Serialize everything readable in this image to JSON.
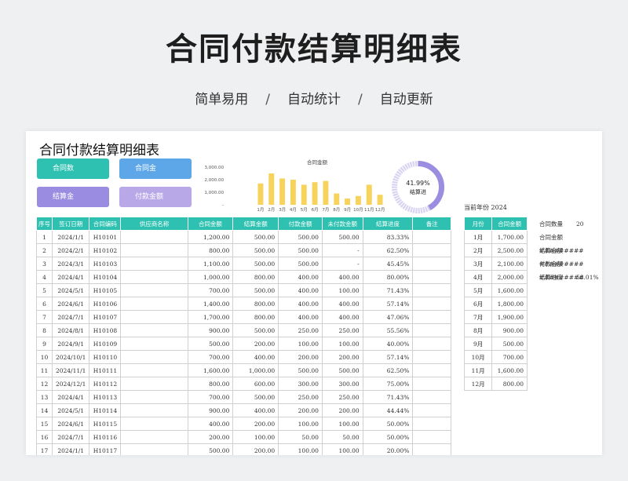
{
  "banner": {
    "title": "合同付款结算明细表",
    "subtitle": [
      "简单易用",
      "自动统计",
      "自动更新"
    ],
    "separator": "/"
  },
  "sheet": {
    "title": "合同付款结算明细表",
    "cards": [
      {
        "label": "合同数",
        "color": "#2ec1b1"
      },
      {
        "label": "合同金",
        "color": "#5da7e8"
      },
      {
        "label": "结算金",
        "color": "#9a8ce0"
      },
      {
        "label": "付款金额",
        "color": "#b8a8e8"
      }
    ],
    "year_label": "当前年份 2024",
    "donut": {
      "percent_text": "41.99%",
      "label": "结算进",
      "value": 0.4199,
      "color": "#9b8ee0",
      "track": "#d9d3f2"
    },
    "summary": [
      {
        "key": "合同数量",
        "value": "20"
      },
      {
        "key": "合同金额",
        "value": "#########"
      },
      {
        "key": "结算金额",
        "value": "#########"
      },
      {
        "key": "付款金额",
        "value": "#########"
      },
      {
        "key": "结算进度",
        "value": "58.01%"
      }
    ]
  },
  "chart_data": {
    "type": "bar",
    "title": "合同金额",
    "categories": [
      "1月",
      "2月",
      "3月",
      "4月",
      "5月",
      "6月",
      "7月",
      "8月",
      "9月",
      "10月",
      "11月",
      "12月"
    ],
    "values": [
      1700,
      2500,
      2100,
      2000,
      1600,
      1800,
      1900,
      900,
      500,
      700,
      1600,
      800
    ],
    "yticks": [
      "3,000.00",
      "2,000.00",
      "1,000.00",
      "-"
    ],
    "ylim": [
      0,
      3000
    ],
    "bar_color": "#f7d35c"
  },
  "main_table": {
    "headers": [
      "序号",
      "签订日期",
      "合同编码",
      "供应商名称",
      "合同金额",
      "结算金额",
      "付款金额",
      "未付款金额",
      "结算进度",
      "备注"
    ],
    "rows": [
      [
        "1",
        "2024/1/1",
        "H10101",
        "",
        "1,200.00",
        "500.00",
        "500.00",
        "500.00",
        "83.33%",
        ""
      ],
      [
        "2",
        "2024/2/1",
        "H10102",
        "",
        "800.00",
        "500.00",
        "500.00",
        "-",
        "62.50%",
        ""
      ],
      [
        "3",
        "2024/3/1",
        "H10103",
        "",
        "1,100.00",
        "500.00",
        "500.00",
        "-",
        "45.45%",
        ""
      ],
      [
        "4",
        "2024/4/1",
        "H10104",
        "",
        "1,000.00",
        "800.00",
        "400.00",
        "400.00",
        "80.00%",
        ""
      ],
      [
        "5",
        "2024/5/1",
        "H10105",
        "",
        "700.00",
        "500.00",
        "400.00",
        "100.00",
        "71.43%",
        ""
      ],
      [
        "6",
        "2024/6/1",
        "H10106",
        "",
        "1,400.00",
        "800.00",
        "400.00",
        "400.00",
        "57.14%",
        ""
      ],
      [
        "7",
        "2024/7/1",
        "H10107",
        "",
        "1,700.00",
        "800.00",
        "400.00",
        "400.00",
        "47.06%",
        ""
      ],
      [
        "8",
        "2024/8/1",
        "H10108",
        "",
        "900.00",
        "500.00",
        "250.00",
        "250.00",
        "55.56%",
        ""
      ],
      [
        "9",
        "2024/9/1",
        "H10109",
        "",
        "500.00",
        "200.00",
        "100.00",
        "100.00",
        "40.00%",
        ""
      ],
      [
        "10",
        "2024/10/1",
        "H10110",
        "",
        "700.00",
        "400.00",
        "200.00",
        "200.00",
        "57.14%",
        ""
      ],
      [
        "11",
        "2024/11/1",
        "H10111",
        "",
        "1,600.00",
        "1,000.00",
        "500.00",
        "500.00",
        "62.50%",
        ""
      ],
      [
        "12",
        "2024/12/1",
        "H10112",
        "",
        "800.00",
        "600.00",
        "300.00",
        "300.00",
        "75.00%",
        ""
      ],
      [
        "13",
        "2024/4/1",
        "H10113",
        "",
        "700.00",
        "500.00",
        "250.00",
        "250.00",
        "71.43%",
        ""
      ],
      [
        "14",
        "2024/5/1",
        "H10114",
        "",
        "900.00",
        "400.00",
        "200.00",
        "200.00",
        "44.44%",
        ""
      ],
      [
        "15",
        "2024/6/1",
        "H10115",
        "",
        "400.00",
        "200.00",
        "100.00",
        "100.00",
        "50.00%",
        ""
      ],
      [
        "16",
        "2024/7/1",
        "H10116",
        "",
        "200.00",
        "100.00",
        "50.00",
        "50.00",
        "50.00%",
        ""
      ],
      [
        "17",
        "2024/1/1",
        "H10117",
        "",
        "500.00",
        "200.00",
        "100.00",
        "100.00",
        "20.00%",
        ""
      ]
    ]
  },
  "month_table": {
    "headers": [
      "月份",
      "合同金额"
    ],
    "rows": [
      [
        "1月",
        "1,700.00"
      ],
      [
        "2月",
        "2,500.00"
      ],
      [
        "3月",
        "2,100.00"
      ],
      [
        "4月",
        "2,000.00"
      ],
      [
        "5月",
        "1,600.00"
      ],
      [
        "6月",
        "1,800.00"
      ],
      [
        "7月",
        "1,900.00"
      ],
      [
        "8月",
        "900.00"
      ],
      [
        "9月",
        "500.00"
      ],
      [
        "10月",
        "700.00"
      ],
      [
        "11月",
        "1,600.00"
      ],
      [
        "12月",
        "800.00"
      ]
    ]
  }
}
